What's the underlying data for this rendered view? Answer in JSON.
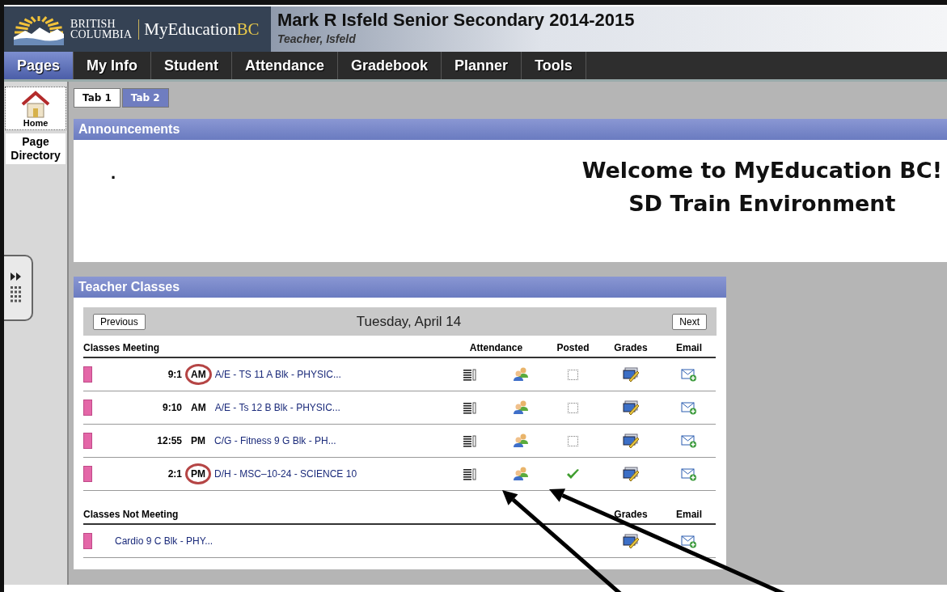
{
  "header": {
    "logo": {
      "line1": "BRITISH",
      "line2": "COLUMBIA",
      "name": "MyEducation",
      "name_suffix": "BC"
    },
    "title": "Mark R Isfeld Senior Secondary 2014-2015",
    "subtitle": "Teacher, Isfeld"
  },
  "nav": [
    {
      "label": "Pages",
      "selected": true
    },
    {
      "label": "My Info",
      "selected": false
    },
    {
      "label": "Student",
      "selected": false
    },
    {
      "label": "Attendance",
      "selected": false
    },
    {
      "label": "Gradebook",
      "selected": false
    },
    {
      "label": "Planner",
      "selected": false
    },
    {
      "label": "Tools",
      "selected": false
    }
  ],
  "sidebar": {
    "items": [
      {
        "label": "Home",
        "kind": "home"
      },
      {
        "label": "Page Directory",
        "kind": "text"
      }
    ]
  },
  "tabs": [
    {
      "label": "Tab 1",
      "selected": true
    },
    {
      "label": "Tab 2",
      "selected": false
    }
  ],
  "announcements": {
    "title": "Announcements",
    "marker": ".",
    "lines": [
      "Welcome to MyEducation BC!",
      "SD Train Environment"
    ]
  },
  "teacher_classes": {
    "title": "Teacher Classes",
    "previous": "Previous",
    "next": "Next",
    "date": "Tuesday, April 14",
    "meeting_heading": "Classes Meeting",
    "columns": [
      "Attendance",
      "Posted",
      "Grades",
      "Email"
    ],
    "meeting": [
      {
        "time": "9:1",
        "period": "AM",
        "circled": true,
        "course": "A/E - TS 11 A Blk - PHYSIC...",
        "posted": false
      },
      {
        "time": "9:10",
        "period": "AM",
        "circled": false,
        "course": "A/E - Ts 12 B Blk - PHYSIC...",
        "posted": false
      },
      {
        "time": "12:55",
        "period": "PM",
        "circled": false,
        "course": "C/G - Fitness 9 G Blk - PH...",
        "posted": false
      },
      {
        "time": "2:1",
        "period": "PM",
        "circled": true,
        "course": "D/H - MSC–10-24 - SCIENCE 10",
        "posted": true
      }
    ],
    "not_meeting_heading": "Classes Not Meeting",
    "not_meeting_columns": [
      "Grades",
      "Email"
    ],
    "not_meeting": [
      {
        "course": "Cardio 9 C Blk - PHY..."
      }
    ]
  }
}
